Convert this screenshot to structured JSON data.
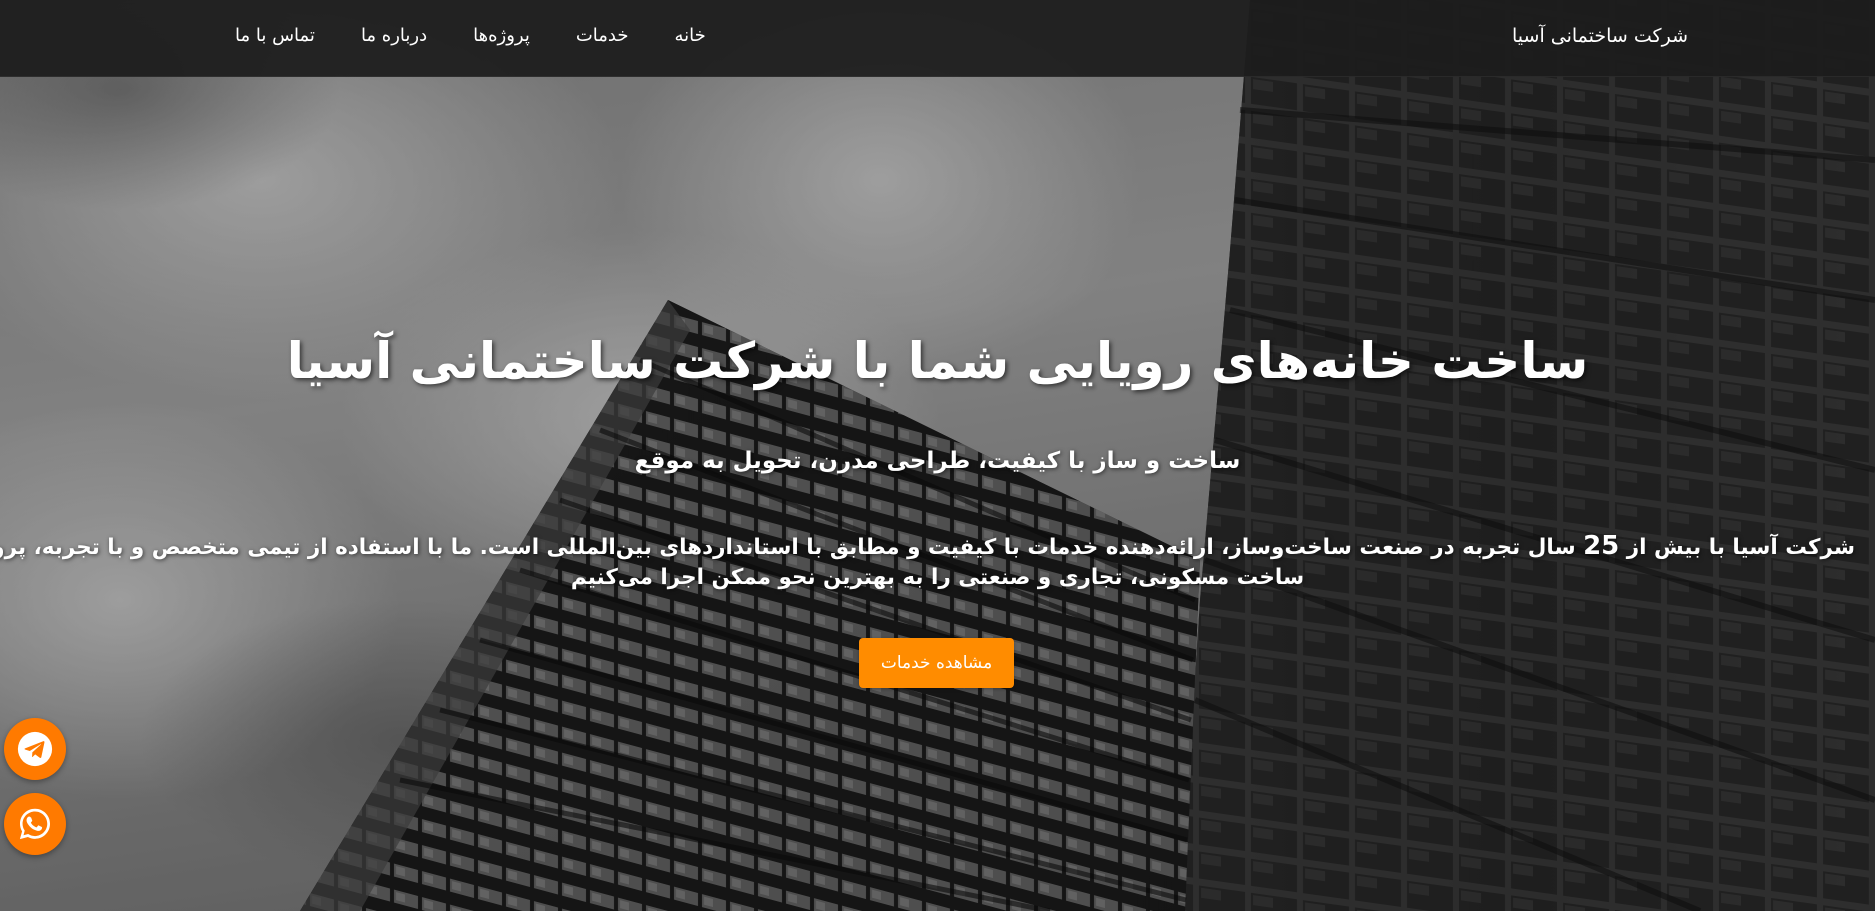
{
  "navbar": {
    "brand": "شرکت ساختمانی آسیا",
    "links": [
      {
        "label": "خانه"
      },
      {
        "label": "خدمات"
      },
      {
        "label": "پروژه‌ها"
      },
      {
        "label": "درباره ما"
      },
      {
        "label": "تماس با ما"
      }
    ]
  },
  "hero": {
    "title": "ساخت خانه‌های رویایی شما با شرکت ساختمانی آسیا",
    "subtitle": "ساخت و ساز با کیفیت، طراحی مدرن، تحویل به موقع",
    "description": {
      "line1_part1": "شرکت آسیا با بیش از",
      "years": "25",
      "line1_part2": "سال تجربه در صنعت ساخت‌وساز، ارائه‌دهنده خدمات با کیفیت و مطابق با استانداردهای بین‌المللی است. ما با استفاده از تیمی متخصص و با تجربه، پروژه‌های",
      "line2": "ساخت مسکونی، تجاری و صنعتی را به بهترین نحو ممکن اجرا می‌کنیم"
    },
    "cta_label": "مشاهده خدمات"
  },
  "floating_buttons": [
    {
      "icon": "telegram-icon"
    },
    {
      "icon": "whatsapp-icon"
    }
  ],
  "colors": {
    "accent": "#ff8c00",
    "float_button": "#ff7a00",
    "navbar_bg": "#1c1c1c",
    "text": "#ffffff"
  }
}
